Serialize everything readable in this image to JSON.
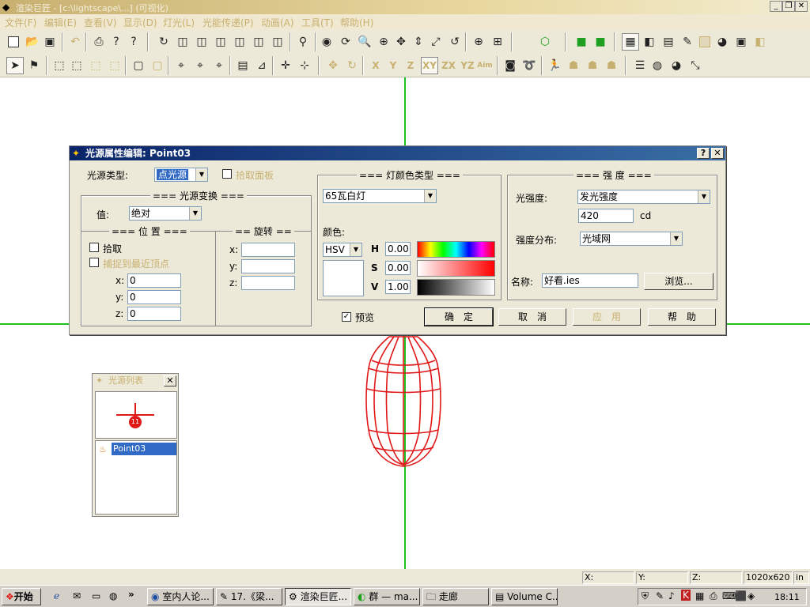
{
  "window": {
    "title": "渲染巨匠 - [c:\\lightscape\\...]  (可视化)"
  },
  "menu": [
    "文件(F)",
    "编辑(E)",
    "查看(V)",
    "显示(D)",
    "灯光(L)",
    "光能传递(P)",
    "动画(A)",
    "工具(T)",
    "帮助(H)"
  ],
  "axis_buttons": [
    "X",
    "Y",
    "Z",
    "XY",
    "ZX",
    "YZ",
    "Aim"
  ],
  "dialog": {
    "title": "光源属性编辑: Point03",
    "source_type_label": "光源类型:",
    "source_type_value": "点光源",
    "pick_panel_label": "拾取面板",
    "transform_group": "=== 光源变换 ===",
    "value_label": "值:",
    "value_value": "绝对",
    "position_group": "=== 位 置 ===",
    "pick_label": "拾取",
    "snap_label": "捕捉到最近顶点",
    "x_label": "x:",
    "y_label": "y:",
    "z_label": "z:",
    "pos_x": "0",
    "pos_y": "0",
    "pos_z": "0",
    "rotation_group": "== 旋转 ==",
    "color_type_group": "=== 灯颜色类型 ===",
    "color_type_value": "65瓦白灯",
    "color_label": "颜色:",
    "color_mode": "HSV",
    "h_label": "H",
    "s_label": "S",
    "v_label": "V",
    "h_value": "0.00",
    "s_value": "0.00",
    "v_value": "1.00",
    "intensity_group": "=== 强 度 ===",
    "intensity_label": "光强度:",
    "intensity_mode": "发光强度",
    "intensity_value": "420",
    "intensity_unit": "cd",
    "distribution_label": "强度分布:",
    "distribution_value": "光域网",
    "name_label": "名称:",
    "name_value": "好看.ies",
    "browse_button": "浏览...",
    "preview_label": "预览",
    "ok_button": "确　定",
    "cancel_button": "取　消",
    "apply_button": "应　用",
    "help_button": "帮　助"
  },
  "scene_panel": {
    "title": "光源列表",
    "item": "Point03",
    "marker": "11"
  },
  "status": {
    "x": "X:",
    "y": "Y:",
    "z": "Z:",
    "resolution": "1020x620",
    "unit": "in"
  },
  "taskbar": {
    "start": "开始",
    "tasks": [
      "室内人论...",
      "17.《梁...",
      "渲染巨匠...",
      "群 — ma...",
      "走廊",
      "Volume C..."
    ],
    "clock": "18:11"
  },
  "colors": {
    "grid": "#20c020",
    "lamp": "#e01818",
    "title_active": "#0a246a",
    "disabled": "#c8b070"
  }
}
